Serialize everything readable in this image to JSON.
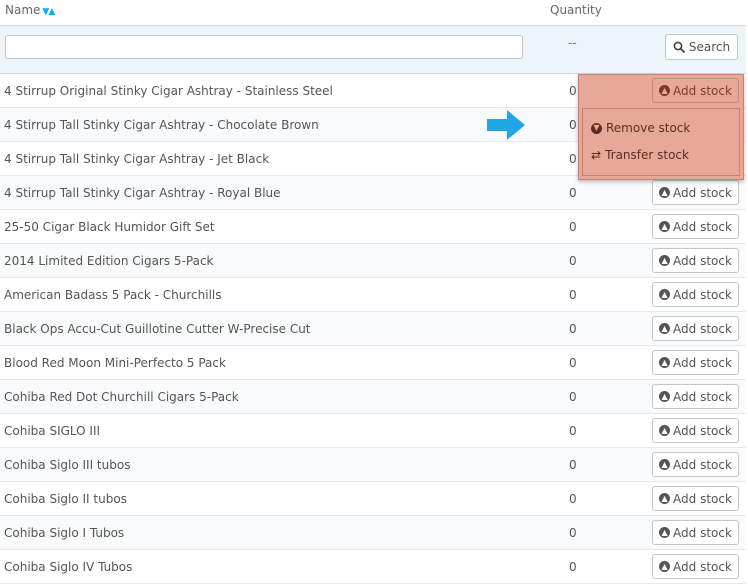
{
  "header": {
    "name_label": "Name",
    "sort_glyph": "▼▲",
    "quantity_label": "Quantity"
  },
  "filter": {
    "name_value": "",
    "quantity_value": "--",
    "search_label": "Search"
  },
  "rows": [
    {
      "name": "4 Stirrup Original Stinky Cigar Ashtray - Stainless Steel",
      "quantity": "0"
    },
    {
      "name": "4 Stirrup Tall Stinky Cigar Ashtray - Chocolate Brown",
      "quantity": "0"
    },
    {
      "name": "4 Stirrup Tall Stinky Cigar Ashtray - Jet Black",
      "quantity": "0"
    },
    {
      "name": "4 Stirrup Tall Stinky Cigar Ashtray - Royal Blue",
      "quantity": "0"
    },
    {
      "name": "25-50 Cigar Black Humidor Gift Set",
      "quantity": "0"
    },
    {
      "name": "2014 Limited Edition Cigars 5-Pack",
      "quantity": "0"
    },
    {
      "name": "American Badass 5 Pack - Churchills",
      "quantity": "0"
    },
    {
      "name": "Black Ops Accu-Cut Guillotine Cutter W-Precise Cut",
      "quantity": "0"
    },
    {
      "name": "Blood Red Moon Mini-Perfecto 5 Pack",
      "quantity": "0"
    },
    {
      "name": "Cohiba Red Dot Churchill Cigars 5-Pack",
      "quantity": "0"
    },
    {
      "name": "Cohiba SIGLO III",
      "quantity": "0"
    },
    {
      "name": "Cohiba Siglo III tubos",
      "quantity": "0"
    },
    {
      "name": "Cohiba Siglo II tubos",
      "quantity": "0"
    },
    {
      "name": "Cohiba Siglo I Tubos",
      "quantity": "0"
    },
    {
      "name": "Cohiba Siglo IV Tubos",
      "quantity": "0"
    }
  ],
  "add_stock_label": "Add stock",
  "dropdown": {
    "remove_label": "Remove stock",
    "transfer_label": "Transfer stock"
  },
  "colors": {
    "highlight": "#e8a898",
    "arrow": "#1ea7e4",
    "sort_icon": "#00aff0"
  }
}
